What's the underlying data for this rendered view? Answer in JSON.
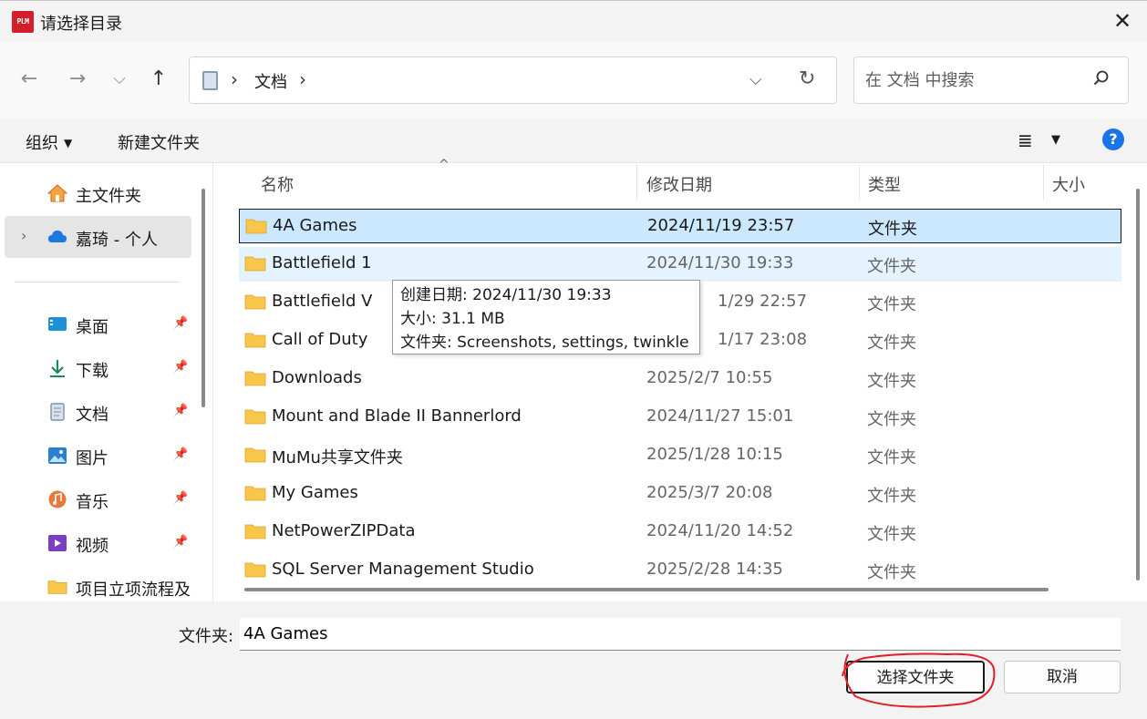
{
  "window": {
    "title": "请选择目录",
    "app_icon_text": "PLM",
    "close_label": "✕"
  },
  "nav": {
    "back": "←",
    "forward": "→",
    "recent": "⌵",
    "up": "↑"
  },
  "address": {
    "separator": "›",
    "crumb": "文档",
    "dropdown": "⌵",
    "refresh": "↻"
  },
  "search": {
    "placeholder": "在 文档 中搜索"
  },
  "toolbar": {
    "organize": "组织",
    "organize_caret": "▼",
    "new_folder": "新建文件夹",
    "view": "≣",
    "view_caret": "▼",
    "help": "?"
  },
  "sidebar": {
    "items": [
      {
        "label": "主文件夹",
        "icon": "home-icon"
      },
      {
        "label": "嘉琦 - 个人",
        "icon": "cloud-icon",
        "expand": "›"
      },
      {
        "label": "桌面",
        "icon": "desktop-icon",
        "pin": "📌"
      },
      {
        "label": "下载",
        "icon": "download-icon",
        "pin": "📌"
      },
      {
        "label": "文档",
        "icon": "document-icon",
        "pin": "📌"
      },
      {
        "label": "图片",
        "icon": "picture-icon",
        "pin": "📌"
      },
      {
        "label": "音乐",
        "icon": "music-icon",
        "pin": "📌"
      },
      {
        "label": "视频",
        "icon": "video-icon",
        "pin": "📌"
      },
      {
        "label": "项目立项流程及",
        "icon": "folder-icon"
      }
    ]
  },
  "columns": {
    "name": "名称",
    "modified": "修改日期",
    "type": "类型",
    "size": "大小",
    "sort_caret": "^"
  },
  "files": [
    {
      "name": "4A Games",
      "modified": "2024/11/19 23:57",
      "type": "文件夹"
    },
    {
      "name": "Battlefield 1",
      "modified": "2024/11/30 19:33",
      "type": "文件夹"
    },
    {
      "name": "Battlefield V",
      "modified": "1/29 22:57",
      "type": "文件夹"
    },
    {
      "name": "Call of Duty",
      "modified": "1/17 23:08",
      "type": "文件夹"
    },
    {
      "name": "Downloads",
      "modified": "2025/2/7 10:55",
      "type": "文件夹"
    },
    {
      "name": "Mount and Blade II Bannerlord",
      "modified": "2024/11/27 15:01",
      "type": "文件夹"
    },
    {
      "name": "MuMu共享文件夹",
      "modified": "2025/1/28 10:15",
      "type": "文件夹"
    },
    {
      "name": "My Games",
      "modified": "2025/3/7 20:08",
      "type": "文件夹"
    },
    {
      "name": "NetPowerZIPData",
      "modified": "2024/11/20 14:52",
      "type": "文件夹"
    },
    {
      "name": "SQL Server Management Studio",
      "modified": "2025/2/28 14:35",
      "type": "文件夹"
    }
  ],
  "tooltip": {
    "line1": "创建日期: 2024/11/30 19:33",
    "line2": "大小: 31.1 MB",
    "line3": "文件夹: Screenshots, settings, twinkle"
  },
  "footer": {
    "folder_label": "文件夹:",
    "folder_value": "4A Games",
    "select_button": "选择文件夹",
    "cancel_button": "取消"
  },
  "colors": {
    "selection": "#cce8ff",
    "hover": "#e5f3ff",
    "folder": "#f8c64a",
    "annotation": "#e0202a",
    "help": "#1a73e8"
  }
}
